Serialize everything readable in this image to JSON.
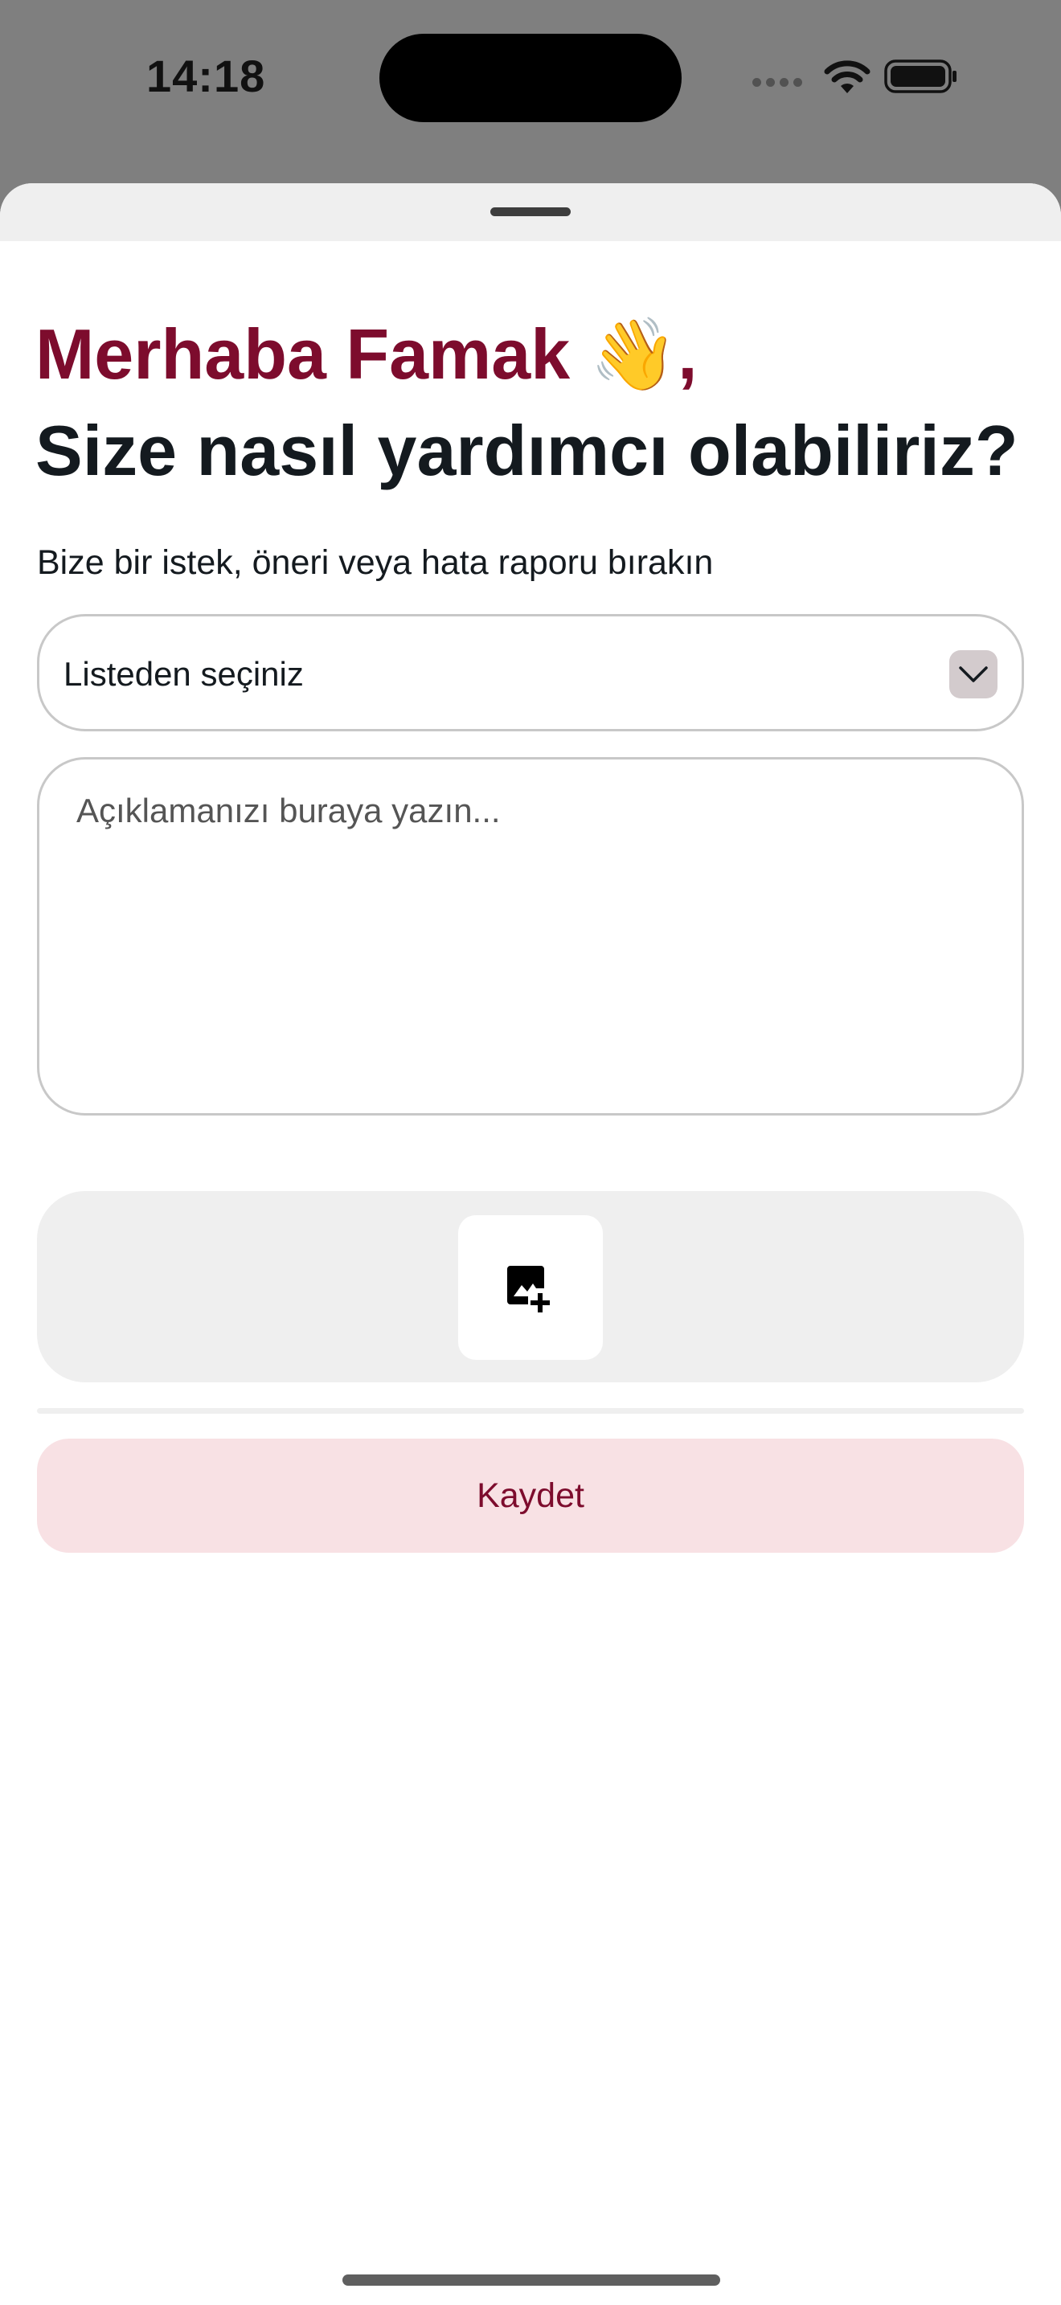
{
  "status_bar": {
    "time": "14:18",
    "icons": [
      "signal-dots-icon",
      "wifi-icon",
      "battery-icon"
    ]
  },
  "feedback": {
    "greeting": "Merhaba Famak 👋,",
    "question": "Size nasıl yardımcı olabiliriz?",
    "subtitle": "Bize bir istek, öneri veya hata raporu bırakın",
    "select_value": "Listeden seçiniz",
    "description_placeholder": "Açıklamanızı buraya yazın...",
    "attach_icon": "add-photo-icon",
    "save_label": "Kaydet"
  },
  "colors": {
    "accent": "#7d0c2d",
    "button_bg": "#f8e1e4",
    "panel_bg": "#efefef",
    "text_dark": "#141a1f"
  }
}
